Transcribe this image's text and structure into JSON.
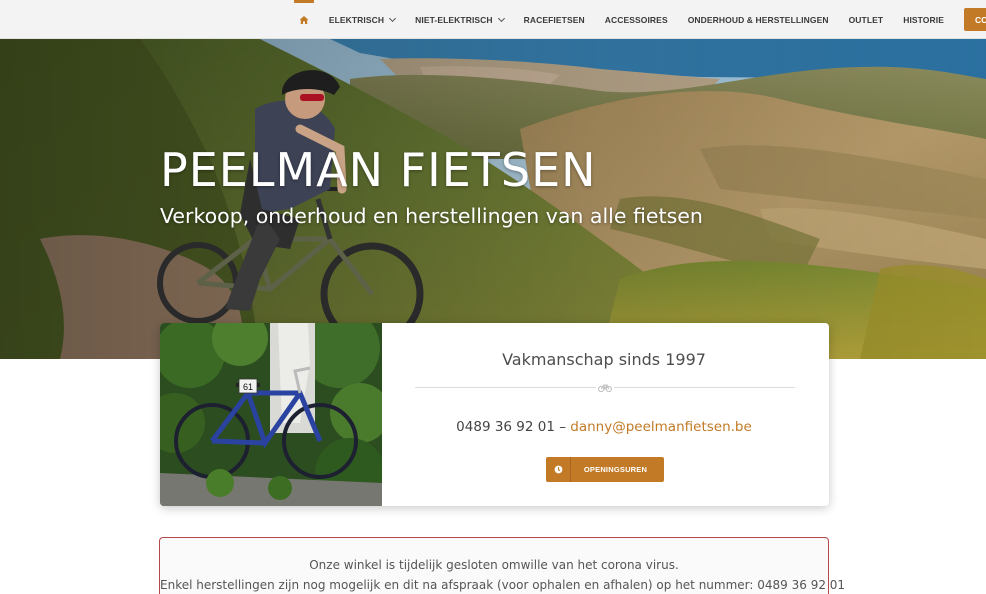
{
  "nav": {
    "home_icon": "home-icon",
    "items": [
      {
        "label": "ELEKTRISCH",
        "dropdown": true
      },
      {
        "label": "NIET-ELEKTRISCH",
        "dropdown": true
      },
      {
        "label": "RACEFIETSEN",
        "dropdown": false
      },
      {
        "label": "ACCESSOIRES",
        "dropdown": false
      },
      {
        "label": "ONDERHOUD & HERSTELLINGEN",
        "dropdown": false
      },
      {
        "label": "OUTLET",
        "dropdown": false
      },
      {
        "label": "HISTORIE",
        "dropdown": false
      }
    ],
    "cta_label": "CO"
  },
  "hero": {
    "title": "PEELMAN FIETSEN",
    "subtitle": "Verkoop, onderhoud en herstellingen van alle fietsen"
  },
  "card": {
    "heading": "Vakmanschap sinds 1997",
    "phone": "0489 36 92 01",
    "separator": "–",
    "email": "danny@peelmanfietsen.be",
    "button_label": "OPENINGSUREN",
    "button_icon": "clock-icon",
    "divider_icon": "bicycle-icon",
    "race_number": "61"
  },
  "notice": {
    "line1": "Onze winkel is tijdelijk gesloten omwille van het corona virus.",
    "line2": "Enkel herstellingen zijn nog mogelijk en dit na afspraak (voor ophalen en afhalen) op het nummer: 0489 36 92 01"
  },
  "colors": {
    "accent": "#c27a26",
    "notice_border": "#b24a4a",
    "nav_bg": "#f3f3f3"
  }
}
